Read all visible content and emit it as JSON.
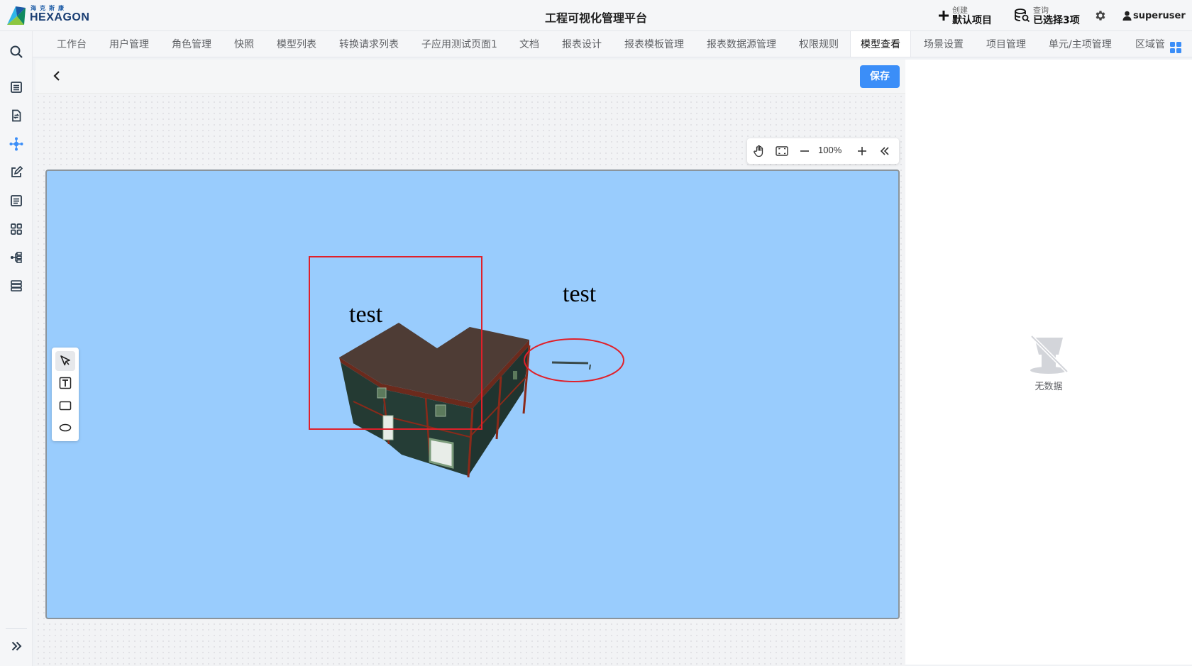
{
  "header": {
    "logo_cn": "海克斯康",
    "logo_en": "HEXAGON",
    "title": "工程可视化管理平台",
    "create_small": "创建",
    "create_big": "默认项目",
    "query_small": "查询",
    "query_big": "已选择3项",
    "username": "superuser"
  },
  "tabs": [
    {
      "label": "工作台"
    },
    {
      "label": "用户管理"
    },
    {
      "label": "角色管理"
    },
    {
      "label": "快照"
    },
    {
      "label": "模型列表"
    },
    {
      "label": "转换请求列表"
    },
    {
      "label": "子应用测试页面1"
    },
    {
      "label": "文档"
    },
    {
      "label": "报表设计"
    },
    {
      "label": "报表模板管理"
    },
    {
      "label": "报表数据源管理"
    },
    {
      "label": "权限规则"
    },
    {
      "label": "模型查看"
    },
    {
      "label": "场景设置"
    },
    {
      "label": "项目管理"
    },
    {
      "label": "单元/主项管理"
    },
    {
      "label": "区域管"
    }
  ],
  "active_tab": "模型查看",
  "toolbar": {
    "save_label": "保存",
    "zoom_level": "100%"
  },
  "annotations": {
    "rect_label": "test",
    "ellipse_label": "test"
  },
  "right_panel": {
    "empty_text": "无数据"
  },
  "colors": {
    "accent": "#3b8ef8",
    "viewport_bg": "#99ccfd",
    "markup_red": "#e0202a"
  }
}
